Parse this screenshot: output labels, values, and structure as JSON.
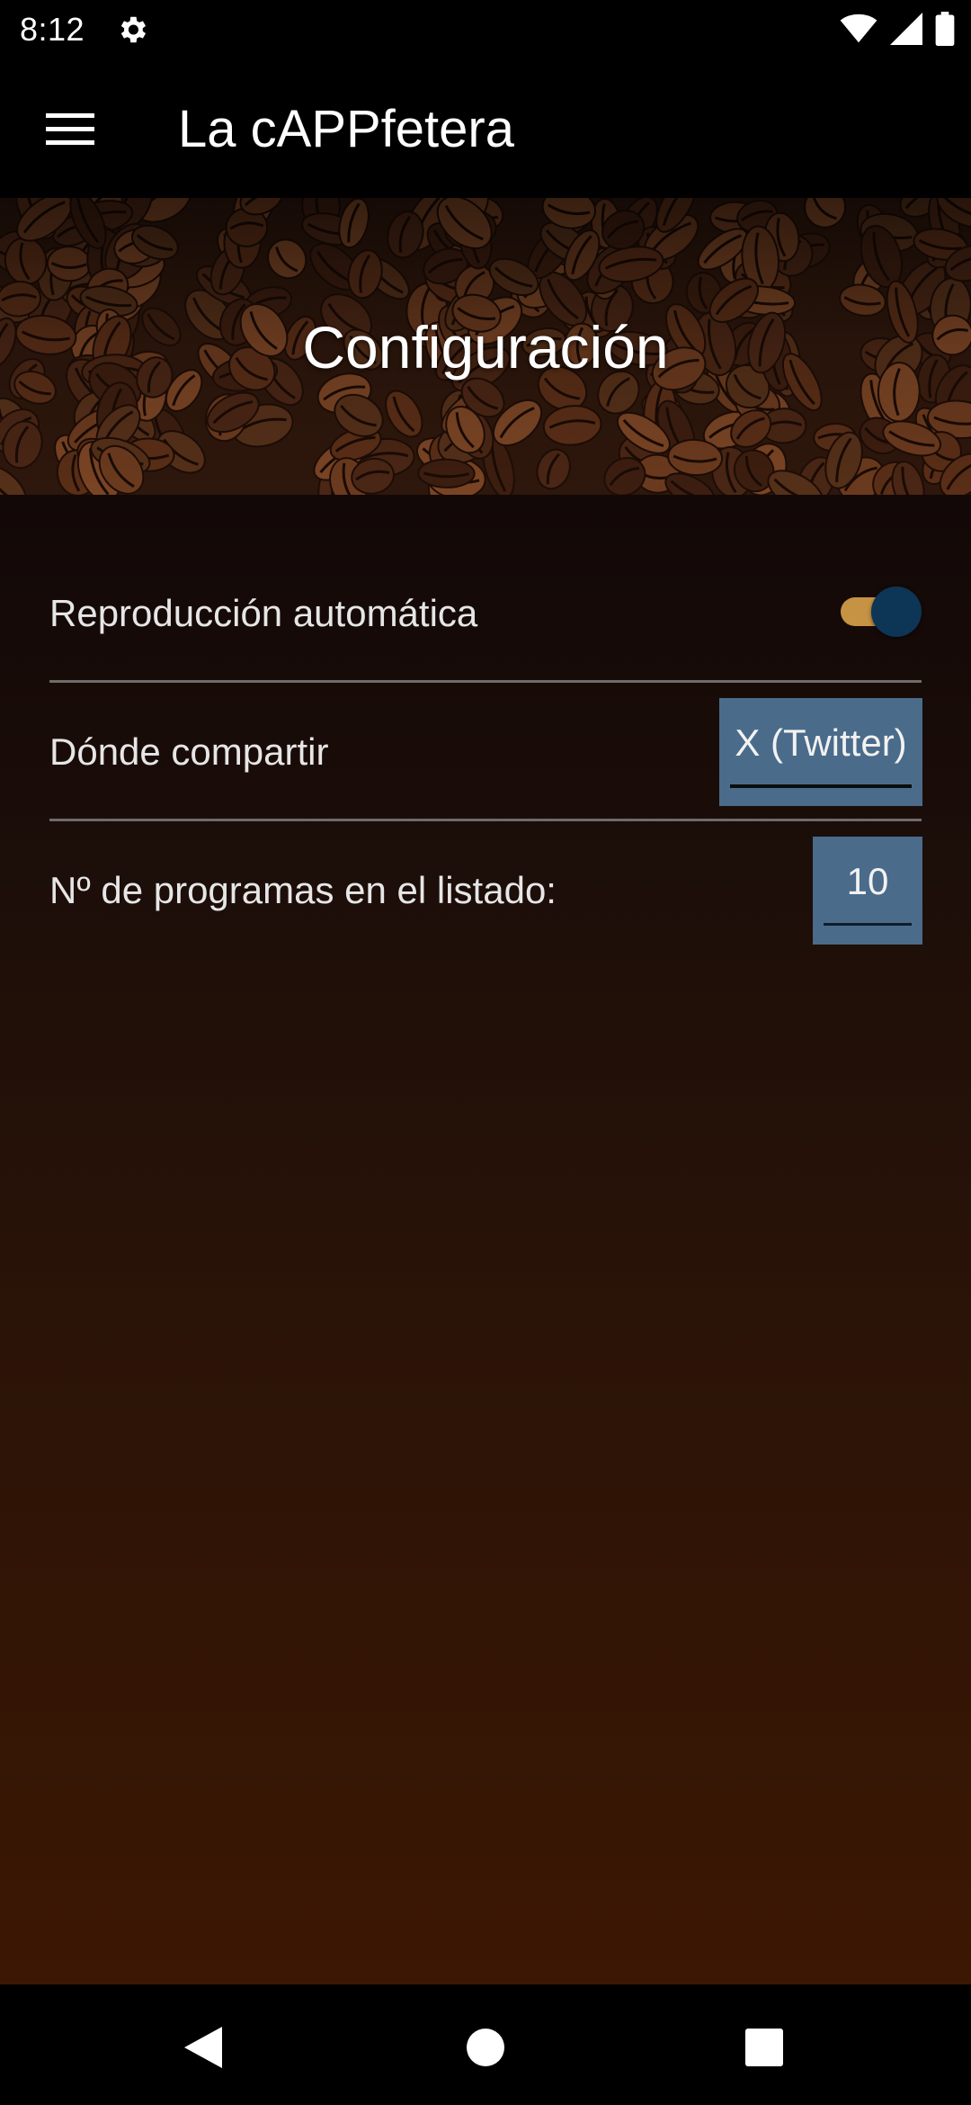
{
  "status_bar": {
    "time": "8:12",
    "icons": [
      "gear-icon",
      "wifi-icon",
      "signal-icon",
      "battery-icon"
    ]
  },
  "app_bar": {
    "title": "La cAPPfetera",
    "menu_icon": "hamburger-menu-icon"
  },
  "banner": {
    "title": "Configuración"
  },
  "settings": {
    "autoplay": {
      "label": "Reproducción automática",
      "enabled": true
    },
    "share": {
      "label": "Dónde compartir",
      "value": "X (Twitter)"
    },
    "count": {
      "label": "Nº de programas en el listado:",
      "value": "10"
    }
  },
  "colors": {
    "toggle_track": "#c69243",
    "toggle_thumb": "#0d3556",
    "field_bg": "#4b6b8a",
    "content_bottom": "#3c1703"
  },
  "nav_bar": {
    "icons": [
      "back-icon",
      "home-icon",
      "recents-icon"
    ]
  }
}
